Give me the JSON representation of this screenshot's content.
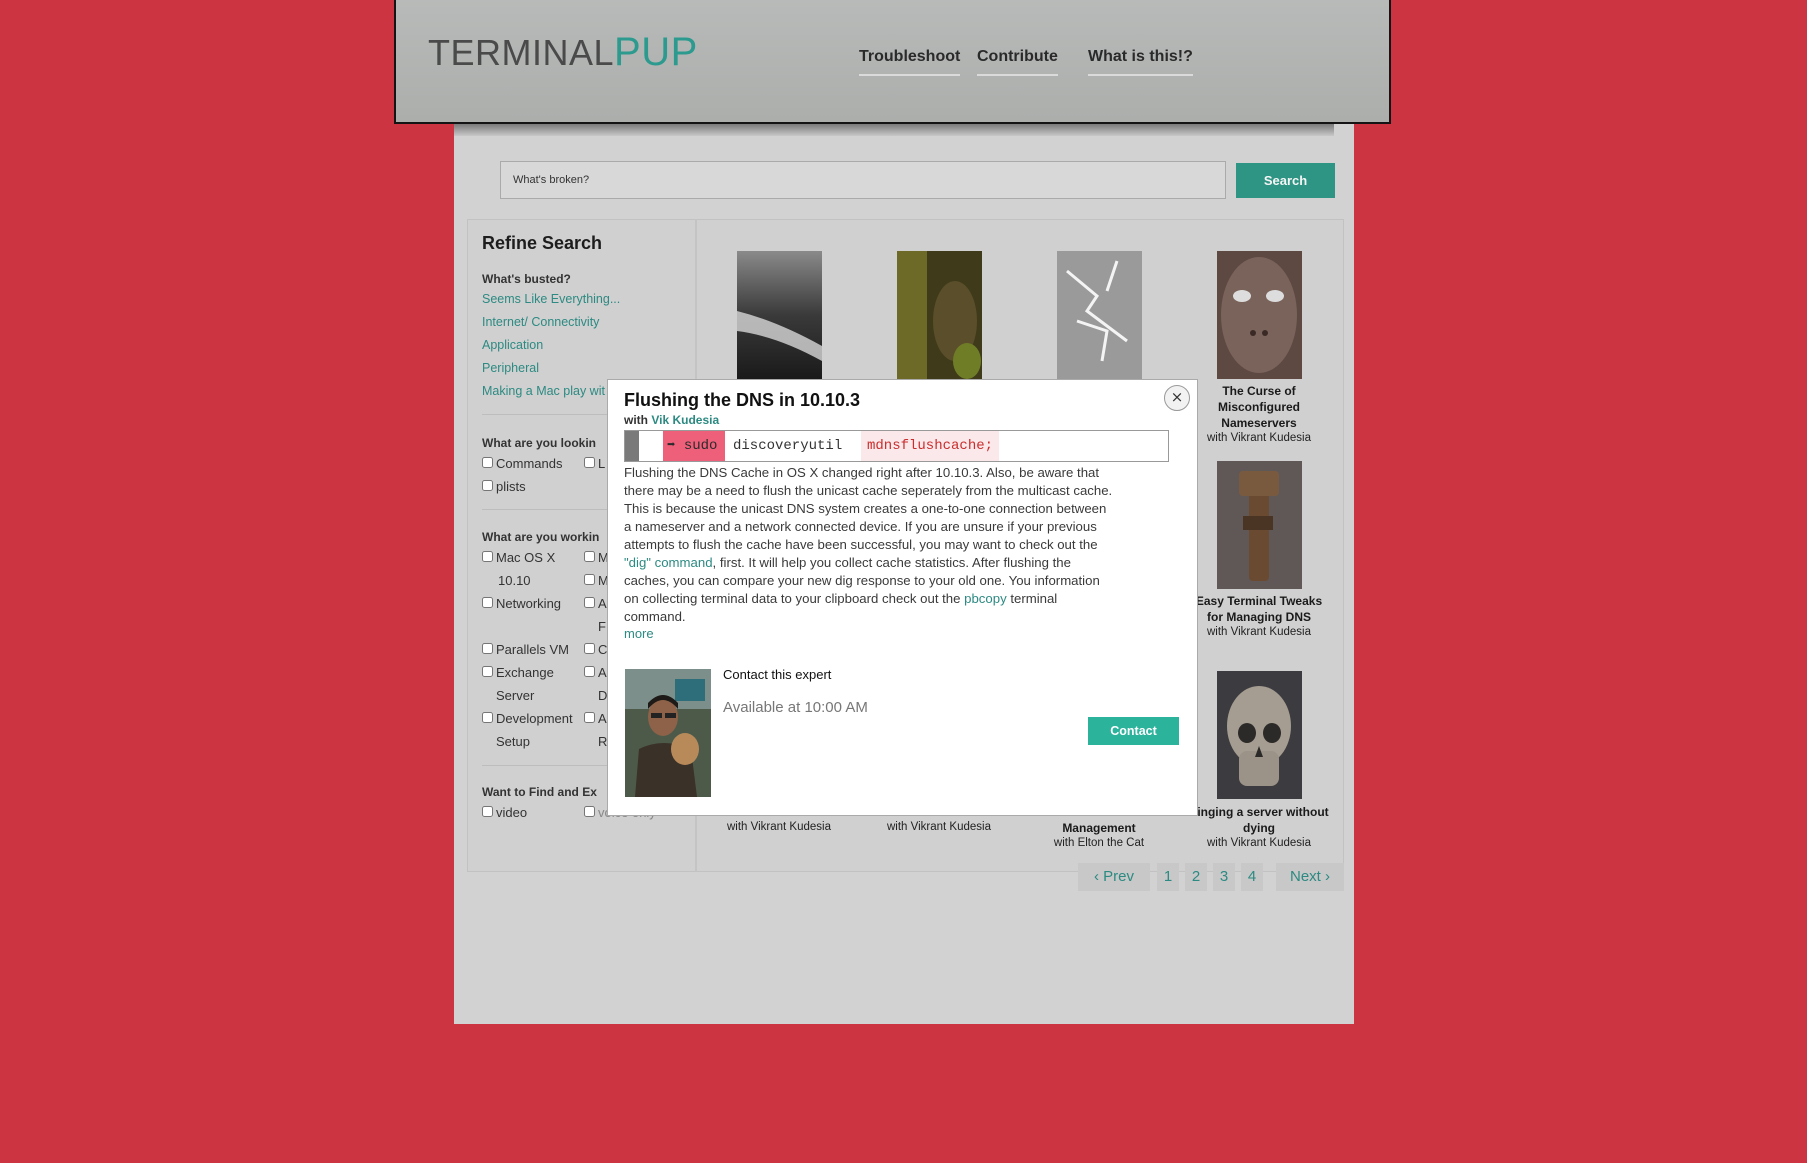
{
  "header": {
    "logo_part1": "TERMINAL",
    "logo_part2": "PUP",
    "nav": [
      "Troubleshoot",
      "Contribute",
      "What is this!?"
    ]
  },
  "search": {
    "value": "What's broken?",
    "button": "Search"
  },
  "sidebar": {
    "title": "Refine Search",
    "busted_heading": "What's busted?",
    "busted_links": [
      "Seems Like Everything...",
      "Internet/ Connectivity",
      "Application",
      "Peripheral",
      "Making a Mac play wit"
    ],
    "looking_heading": "What are you lookin",
    "looking_options": [
      "Commands",
      "L",
      "plists"
    ],
    "working_heading": "What are you workin",
    "working_options": {
      "macosx_1": "Mac OS X",
      "macosx_2": "10.10",
      "m1": "M",
      "m2": "M",
      "networking": "Networking",
      "a1": "A",
      "r1": "F",
      "parallels": "Parallels VM",
      "c1": "C",
      "exchange_1": "Exchange",
      "exchange_2": "Server",
      "a2": "A",
      "d1": "D",
      "dev_1": "Development",
      "dev_2": "Setup",
      "a3": "A",
      "r2": "R"
    },
    "find_heading": "Want to Find and Ex",
    "find_options": [
      "video",
      "voice only"
    ]
  },
  "cards": [
    {
      "title": "The Curse of Misconfigured Nameservers",
      "author": "with Vikrant Kudesia"
    },
    {
      "title": "Easy Terminal Tweaks for Managing DNS",
      "author": "with Vikrant Kudesia"
    },
    {
      "title": "",
      "author": "with Vikrant Kudesia"
    },
    {
      "title": "",
      "author": "with Vikrant Kudesia"
    },
    {
      "title": "Management",
      "author": "with Elton the Cat"
    },
    {
      "title": "Pinging a server without dying",
      "author": "with Vikrant Kudesia"
    }
  ],
  "pagination": {
    "prev": "‹ Prev",
    "pages": [
      "1",
      "2",
      "3",
      "4"
    ],
    "next": "Next ›"
  },
  "modal": {
    "title": "Flushing the DNS in 10.10.3",
    "with": "with",
    "author": "Vik Kudesia",
    "close": "×",
    "command": {
      "prefix": "➡ sudo",
      "tool": "discoveryutil",
      "arg": "mdnsflushcache;"
    },
    "body_1": "Flushing the DNS Cache in OS X changed right after 10.10.3. Also, be aware that there may be a need to flush the unicast cache seperately from the multicast cache. This is because the unicast DNS system creates a one-to-one connection between a nameserver and a network connected device. If you are unsure if your previous attempts to flush the cache have been successful, you may want to check out the ",
    "link_1": "\"dig\" command",
    "body_2": ", first. It will help you collect cache statistics. After flushing the caches, you can compare your new dig response to your old one. You information on collecting terminal data to your clipboard check out the ",
    "link_2": "pbcopy",
    "body_3": " terminal command.",
    "more": "more",
    "contact_heading": "Contact this expert",
    "availability": "Available at 10:00 AM",
    "contact_button": "Contact"
  },
  "colors": {
    "background": "#cc3442",
    "accent": "#2c9a8e",
    "contact": "#2cb39c",
    "sudo": "#ee5f7a"
  }
}
